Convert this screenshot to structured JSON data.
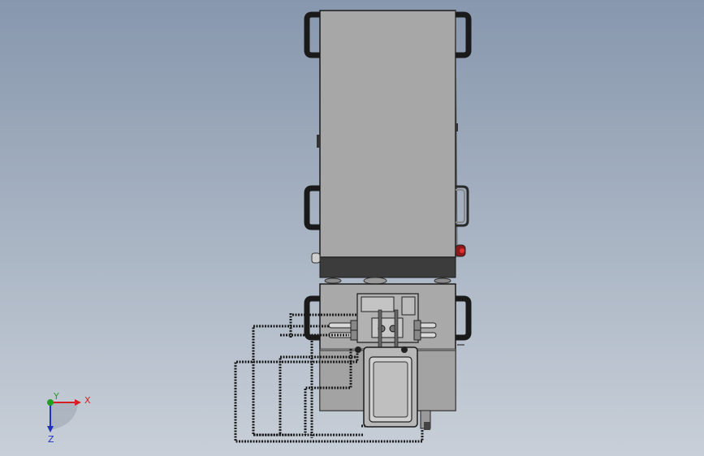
{
  "triad": {
    "x_label": "X",
    "y_label": "Y",
    "z_label": "Z"
  },
  "colors": {
    "background_top": "#8797ad",
    "background_bottom": "#c8cfd8",
    "body": "#a7a7a7",
    "body_edge": "#1a1a1a",
    "dark_band": "#3c3c3c",
    "handle": "#1a1a1a",
    "x_axis": "#d42020",
    "y_axis": "#20a020",
    "z_axis": "#2030c0"
  }
}
